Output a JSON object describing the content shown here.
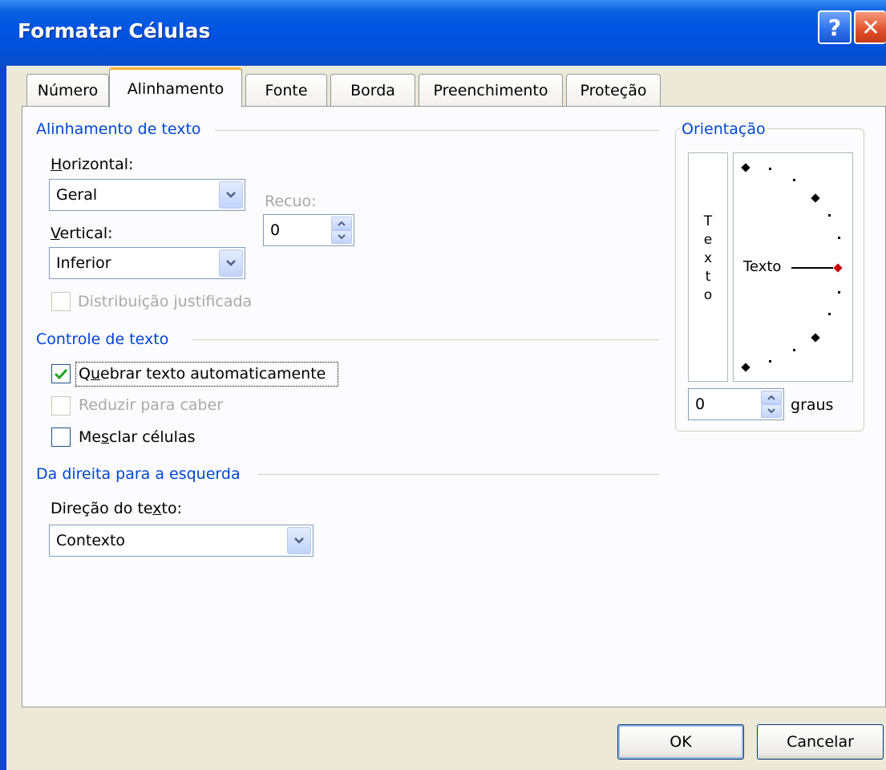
{
  "window": {
    "title": "Formatar Células",
    "help_label": "?",
    "close_label": "✕"
  },
  "tabs": [
    {
      "label": "Número"
    },
    {
      "label": "Alinhamento",
      "active": true
    },
    {
      "label": "Fonte"
    },
    {
      "label": "Borda"
    },
    {
      "label": "Preenchimento"
    },
    {
      "label": "Proteção"
    }
  ],
  "text_alignment": {
    "group_title": "Alinhamento de texto",
    "horizontal_label_u": "H",
    "horizontal_label_rest": "orizontal:",
    "horizontal_value": "Geral",
    "indent_label": "Recuo:",
    "indent_value": "0",
    "vertical_label_u": "V",
    "vertical_label_rest": "ertical:",
    "vertical_value": "Inferior",
    "justify_distributed_label": "Distribuição justificada"
  },
  "text_control": {
    "group_title": "Controle de texto",
    "wrap_text_pre": "Q",
    "wrap_text_u": "u",
    "wrap_text_rest": "ebrar texto automaticamente",
    "wrap_text_checked": true,
    "shrink_to_fit_label": "Reduzir para caber",
    "merge_pre": "Me",
    "merge_u": "s",
    "merge_rest": "clar células"
  },
  "rtl": {
    "group_title": "Da direita para a esquerda",
    "direction_label_pre": "Direção do te",
    "direction_label_u": "x",
    "direction_label_rest": "to:",
    "direction_value": "Contexto"
  },
  "orientation": {
    "group_title": "Orientação",
    "vertical_text": [
      "T",
      "e",
      "x",
      "t",
      "o"
    ],
    "dial_text": "Texto",
    "degrees_value": "0",
    "degrees_label_u": "g",
    "degrees_label_rest": "raus"
  },
  "buttons": {
    "ok": "OK",
    "cancel": "Cancelar"
  },
  "colors": {
    "accent": "#0046d5",
    "active_tab_top": "#f8b335",
    "dial_pointer": "#cc0000",
    "check": "#21a121"
  }
}
